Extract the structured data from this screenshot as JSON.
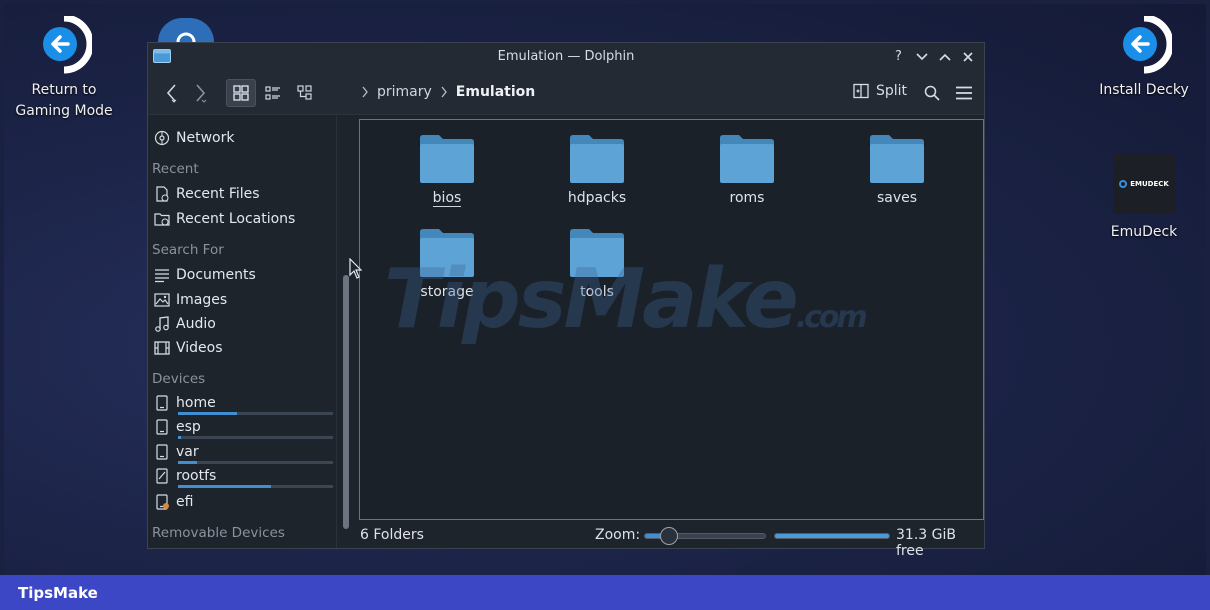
{
  "desktop": {
    "return_label_1": "Return to",
    "return_label_2": "Gaming Mode",
    "decky_label": "Install Decky",
    "emudeck_label": "EmuDeck",
    "emudeck_logo_text": "EMUDECK"
  },
  "window": {
    "title": "Emulation — Dolphin",
    "help_label": "?",
    "split_label": "Split"
  },
  "breadcrumb": {
    "parent": "primary",
    "current": "Emulation"
  },
  "sidebar": {
    "network": "Network",
    "recent_head": "Recent",
    "recent_files": "Recent Files",
    "recent_locations": "Recent Locations",
    "search_head": "Search For",
    "documents": "Documents",
    "images": "Images",
    "audio": "Audio",
    "videos": "Videos",
    "devices_head": "Devices",
    "devices": [
      {
        "label": "home",
        "usage": 0.38
      },
      {
        "label": "esp",
        "usage": 0.02
      },
      {
        "label": "var",
        "usage": 0.12
      },
      {
        "label": "rootfs",
        "usage": 0.6
      },
      {
        "label": "efi"
      }
    ],
    "removable_head": "Removable Devices"
  },
  "folders": [
    "bios",
    "hdpacks",
    "roms",
    "saves",
    "storage",
    "tools"
  ],
  "status": {
    "count": "6 Folders",
    "zoom_label": "Zoom:",
    "zoom_level": 0.2,
    "free_fill": 1.0,
    "free": "31.3 GiB free"
  },
  "watermark": {
    "main": "TipsMake",
    "suffix": ".com"
  },
  "footer_brand": "TipsMake",
  "colors": {
    "accent": "#3f8fd2",
    "folder": "#5ea3d6",
    "frame": "#3a45b5"
  }
}
